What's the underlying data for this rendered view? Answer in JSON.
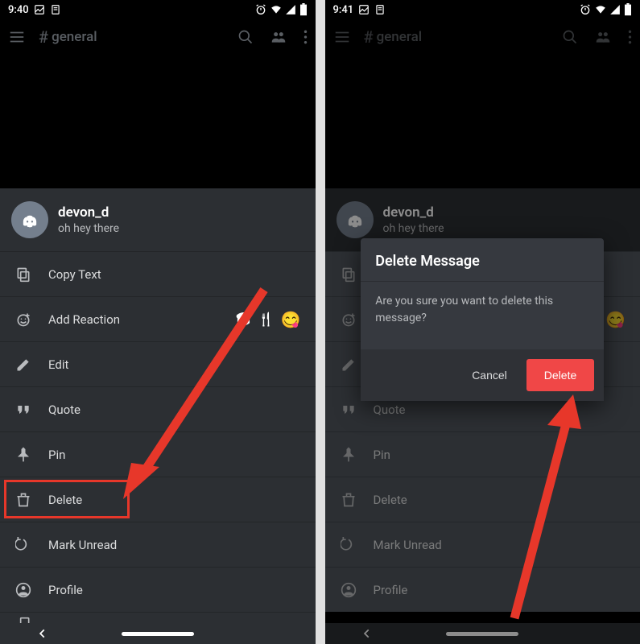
{
  "status": {
    "time_left": "9:40",
    "time_right": "9:41"
  },
  "header": {
    "channel": "general"
  },
  "message": {
    "username": "devon_d",
    "content": "oh hey there"
  },
  "menu": {
    "copy_text": "Copy Text",
    "add_reaction": "Add Reaction",
    "edit": "Edit",
    "quote": "Quote",
    "pin": "Pin",
    "delete": "Delete",
    "mark_unread": "Mark Unread",
    "profile": "Profile"
  },
  "modal": {
    "title": "Delete Message",
    "body": "Are you sure you want to delete this message?",
    "cancel": "Cancel",
    "delete": "Delete"
  }
}
